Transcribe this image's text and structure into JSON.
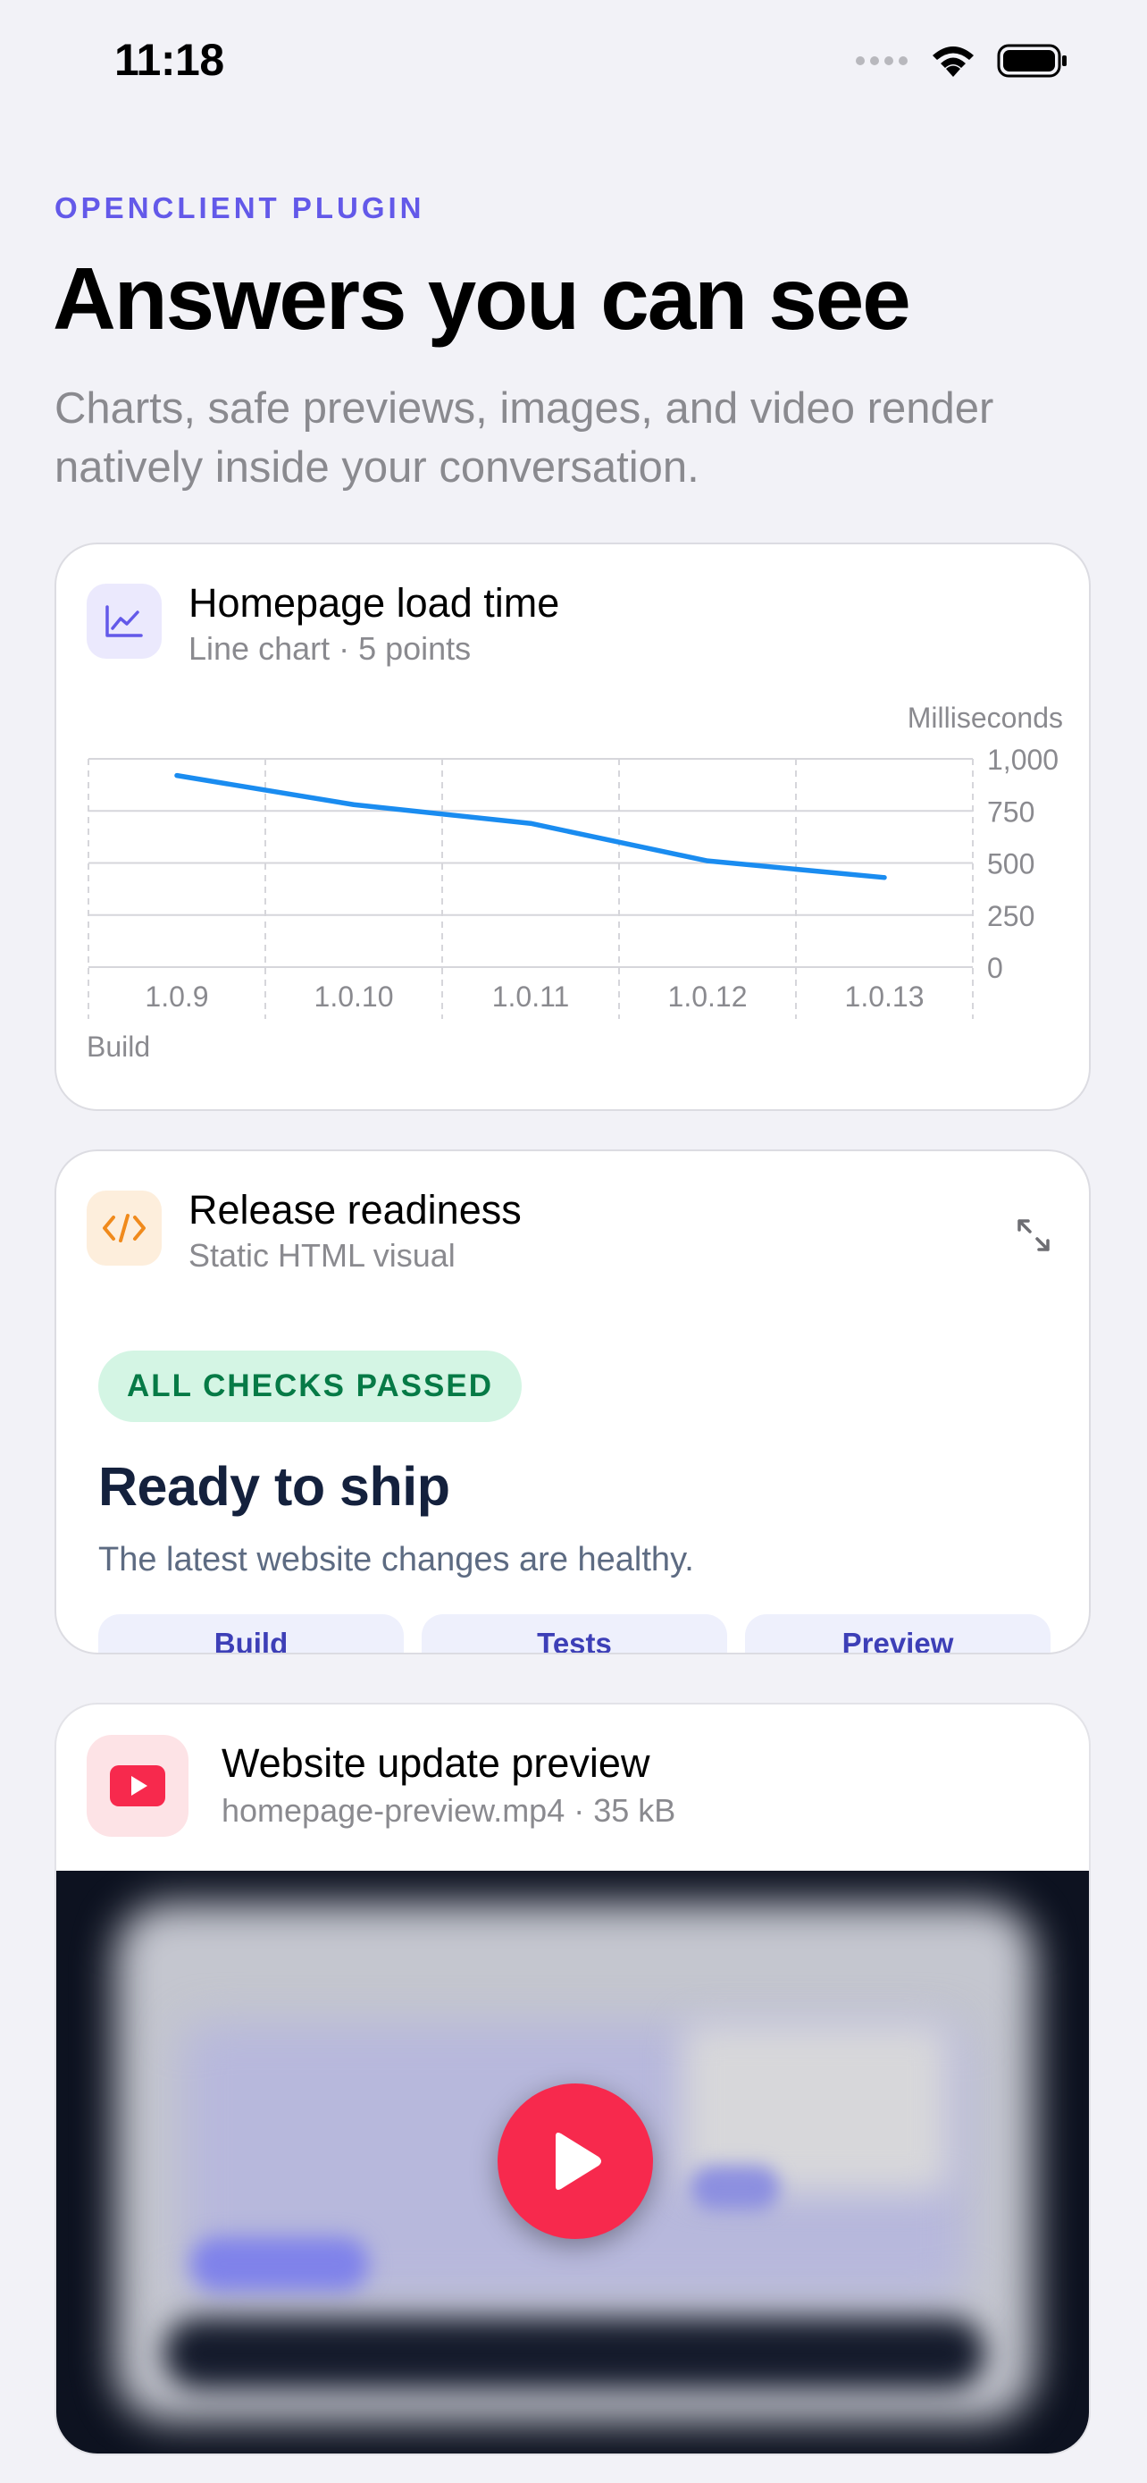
{
  "status_bar": {
    "time": "11:18"
  },
  "header": {
    "eyebrow": "OPENCLIENT PLUGIN",
    "title": "Answers you can see",
    "subtitle": "Charts, safe previews, images, and video render natively inside your conversation."
  },
  "chart_card": {
    "title": "Homepage load time",
    "subtitle": "Line chart · 5 points",
    "icon": "line-chart-icon",
    "accent": "#6359e9"
  },
  "chart_data": {
    "type": "line",
    "categories": [
      "1.0.9",
      "1.0.10",
      "1.0.11",
      "1.0.12",
      "1.0.13"
    ],
    "series": [
      {
        "values": [
          920,
          780,
          690,
          510,
          430
        ]
      }
    ],
    "xlabel": "Build",
    "ylabel": "Milliseconds",
    "ylim": [
      0,
      1000
    ],
    "yticks": [
      "1,000",
      "750",
      "500",
      "250",
      "0"
    ],
    "ytick_values": [
      1000,
      750,
      500,
      250,
      0
    ],
    "grid": true,
    "line_color": "#1a8cf0"
  },
  "readiness_card": {
    "title": "Release readiness",
    "subtitle": "Static HTML visual",
    "icon": "code-icon",
    "badge": "ALL CHECKS PASSED",
    "heading": "Ready to ship",
    "description": "The latest website changes are healthy.",
    "pills": [
      "Build",
      "Tests",
      "Preview"
    ],
    "badge_color": "#067a46"
  },
  "video_card": {
    "title": "Website update preview",
    "file": "homepage-preview.mp4 · 35 kB",
    "icon": "youtube-play-icon",
    "play_color": "#f7294d"
  }
}
